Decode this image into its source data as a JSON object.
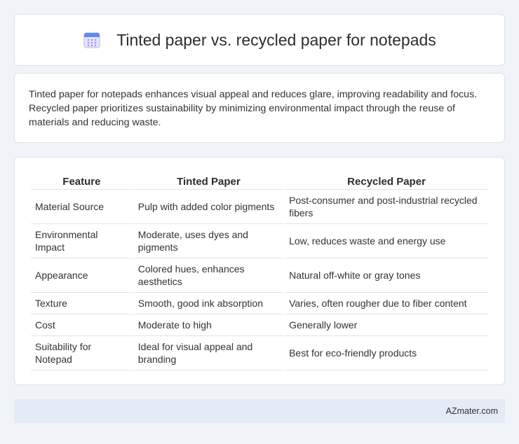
{
  "header": {
    "icon": "calendar-icon",
    "title": "Tinted paper vs. recycled paper for notepads"
  },
  "intro": {
    "text": "Tinted paper for notepads enhances visual appeal and reduces glare, improving readability and focus. Recycled paper prioritizes sustainability by minimizing environmental impact through the reuse of materials and reducing waste."
  },
  "table": {
    "headers": [
      "Feature",
      "Tinted Paper",
      "Recycled Paper"
    ],
    "rows": [
      [
        "Material Source",
        "Pulp with added color pigments",
        "Post-consumer and post-industrial recycled fibers"
      ],
      [
        "Environmental Impact",
        "Moderate, uses dyes and pigments",
        "Low, reduces waste and energy use"
      ],
      [
        "Appearance",
        "Colored hues, enhances aesthetics",
        "Natural off-white or gray tones"
      ],
      [
        "Texture",
        "Smooth, good ink absorption",
        "Varies, often rougher due to fiber content"
      ],
      [
        "Cost",
        "Moderate to high",
        "Generally lower"
      ],
      [
        "Suitability for Notepad",
        "Ideal for visual appeal and branding",
        "Best for eco-friendly products"
      ]
    ]
  },
  "footer": {
    "brand": "AZmater.com"
  },
  "colors": {
    "background": "#f0f3f8",
    "footer_bg": "#e4eaf6",
    "icon_accent": "#5b8def"
  }
}
